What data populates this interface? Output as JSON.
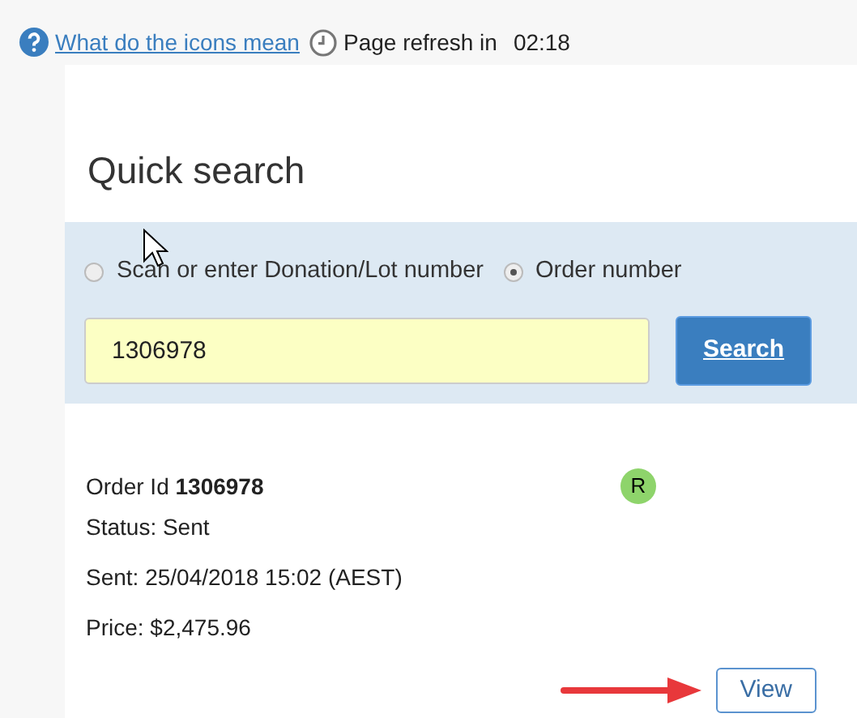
{
  "top_bar": {
    "help_link": "What do the icons mean",
    "refresh_label": "Page refresh in",
    "refresh_time": "02:18"
  },
  "quick_search": {
    "title": "Quick search",
    "options": [
      {
        "label": "Scan or enter Donation/Lot number",
        "selected": false
      },
      {
        "label": "Order number",
        "selected": true
      }
    ],
    "input": {
      "value": "1306978"
    },
    "button": "Search"
  },
  "result": {
    "order_id": "Order Id **1306978**",
    "badge": {
      "label": "R",
      "color": "#8ed46b"
    },
    "status": "Status: Sent",
    "sent": "Sent: 25/04/2018 15:02 (AEST)",
    "price": "Price: $2,475.96",
    "view_button": "View"
  }
}
